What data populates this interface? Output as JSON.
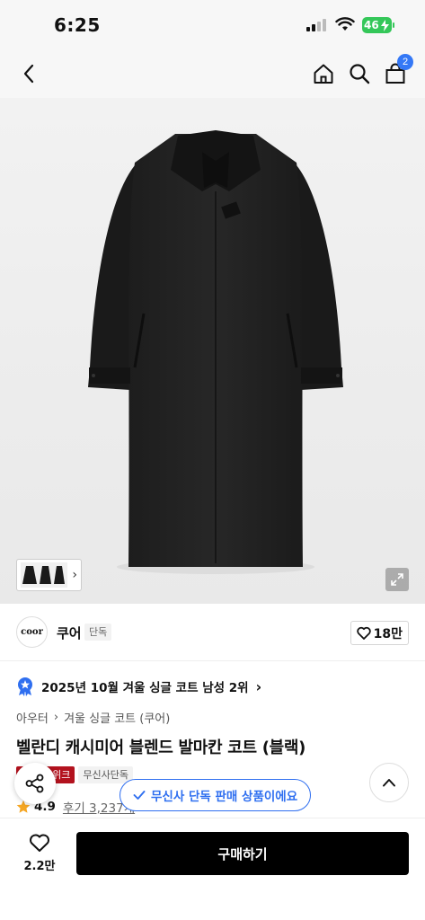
{
  "status_bar": {
    "time": "6:25",
    "battery": "46"
  },
  "nav": {
    "cart_count": "2"
  },
  "brand": {
    "logo_text": "coor",
    "name": "쿠어",
    "exclusive_tag": "단독",
    "likes": "18만"
  },
  "ranking": {
    "text": "2025년 10월 겨울 싱글 코트 남성 2위"
  },
  "breadcrumb": {
    "level1": "아우터",
    "level2": "겨울 싱글 코트 (쿠어)"
  },
  "product": {
    "title": "벨란디 캐시미어 블렌드 발마칸 코트 (블랙)"
  },
  "tags": {
    "sale": "스위크",
    "store": "무신사단독"
  },
  "rating": {
    "score": "4.9",
    "reviews": "후기 3,237개"
  },
  "toast": {
    "text": "무신사 단독 판매 상품이에요"
  },
  "bottom": {
    "like_count": "2.2만",
    "buy_label": "구매하기"
  },
  "colors": {
    "accent_blue": "#2f6ff0",
    "sale_red": "#b3121e",
    "battery_green": "#34c759"
  }
}
